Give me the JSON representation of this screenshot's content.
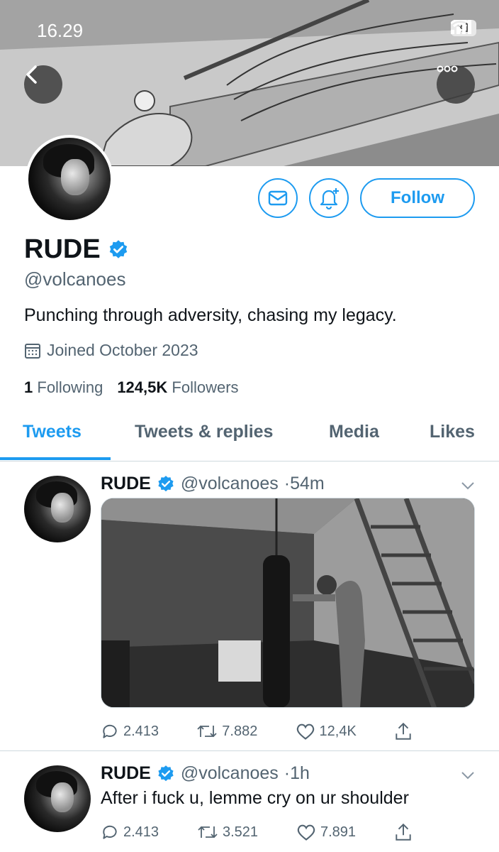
{
  "status_bar": {
    "time": "16.29",
    "battery": "31"
  },
  "header": {
    "back_icon": "chevron-left-icon",
    "more_icon": "more-horizontal-icon"
  },
  "profile": {
    "name": "RUDE",
    "handle": "@volcanoes",
    "bio": "Punching through adversity, chasing my legacy.",
    "joined": "Joined October 2023",
    "following_count": "1",
    "following_label": "Following",
    "followers_count": "124,5K",
    "followers_label": "Followers",
    "follow_label": "Follow"
  },
  "tabs": [
    {
      "label": "Tweets",
      "active": true
    },
    {
      "label": "Tweets & replies",
      "active": false
    },
    {
      "label": "Media",
      "active": false
    },
    {
      "label": "Likes",
      "active": false
    }
  ],
  "tweets": [
    {
      "name": "RUDE",
      "handle": "@volcanoes",
      "time": "·54m",
      "text": "",
      "has_media": true,
      "replies": "2.413",
      "retweets": "7.882",
      "likes": "12,4K"
    },
    {
      "name": "RUDE",
      "handle": "@volcanoes",
      "time": "·1h",
      "text": "After i fuck u, lemme cry on ur shoulder",
      "has_media": false,
      "replies": "2.413",
      "retweets": "3.521",
      "likes": "7.891"
    }
  ],
  "colors": {
    "accent": "#1d9bf0",
    "secondary_text": "#536471"
  }
}
